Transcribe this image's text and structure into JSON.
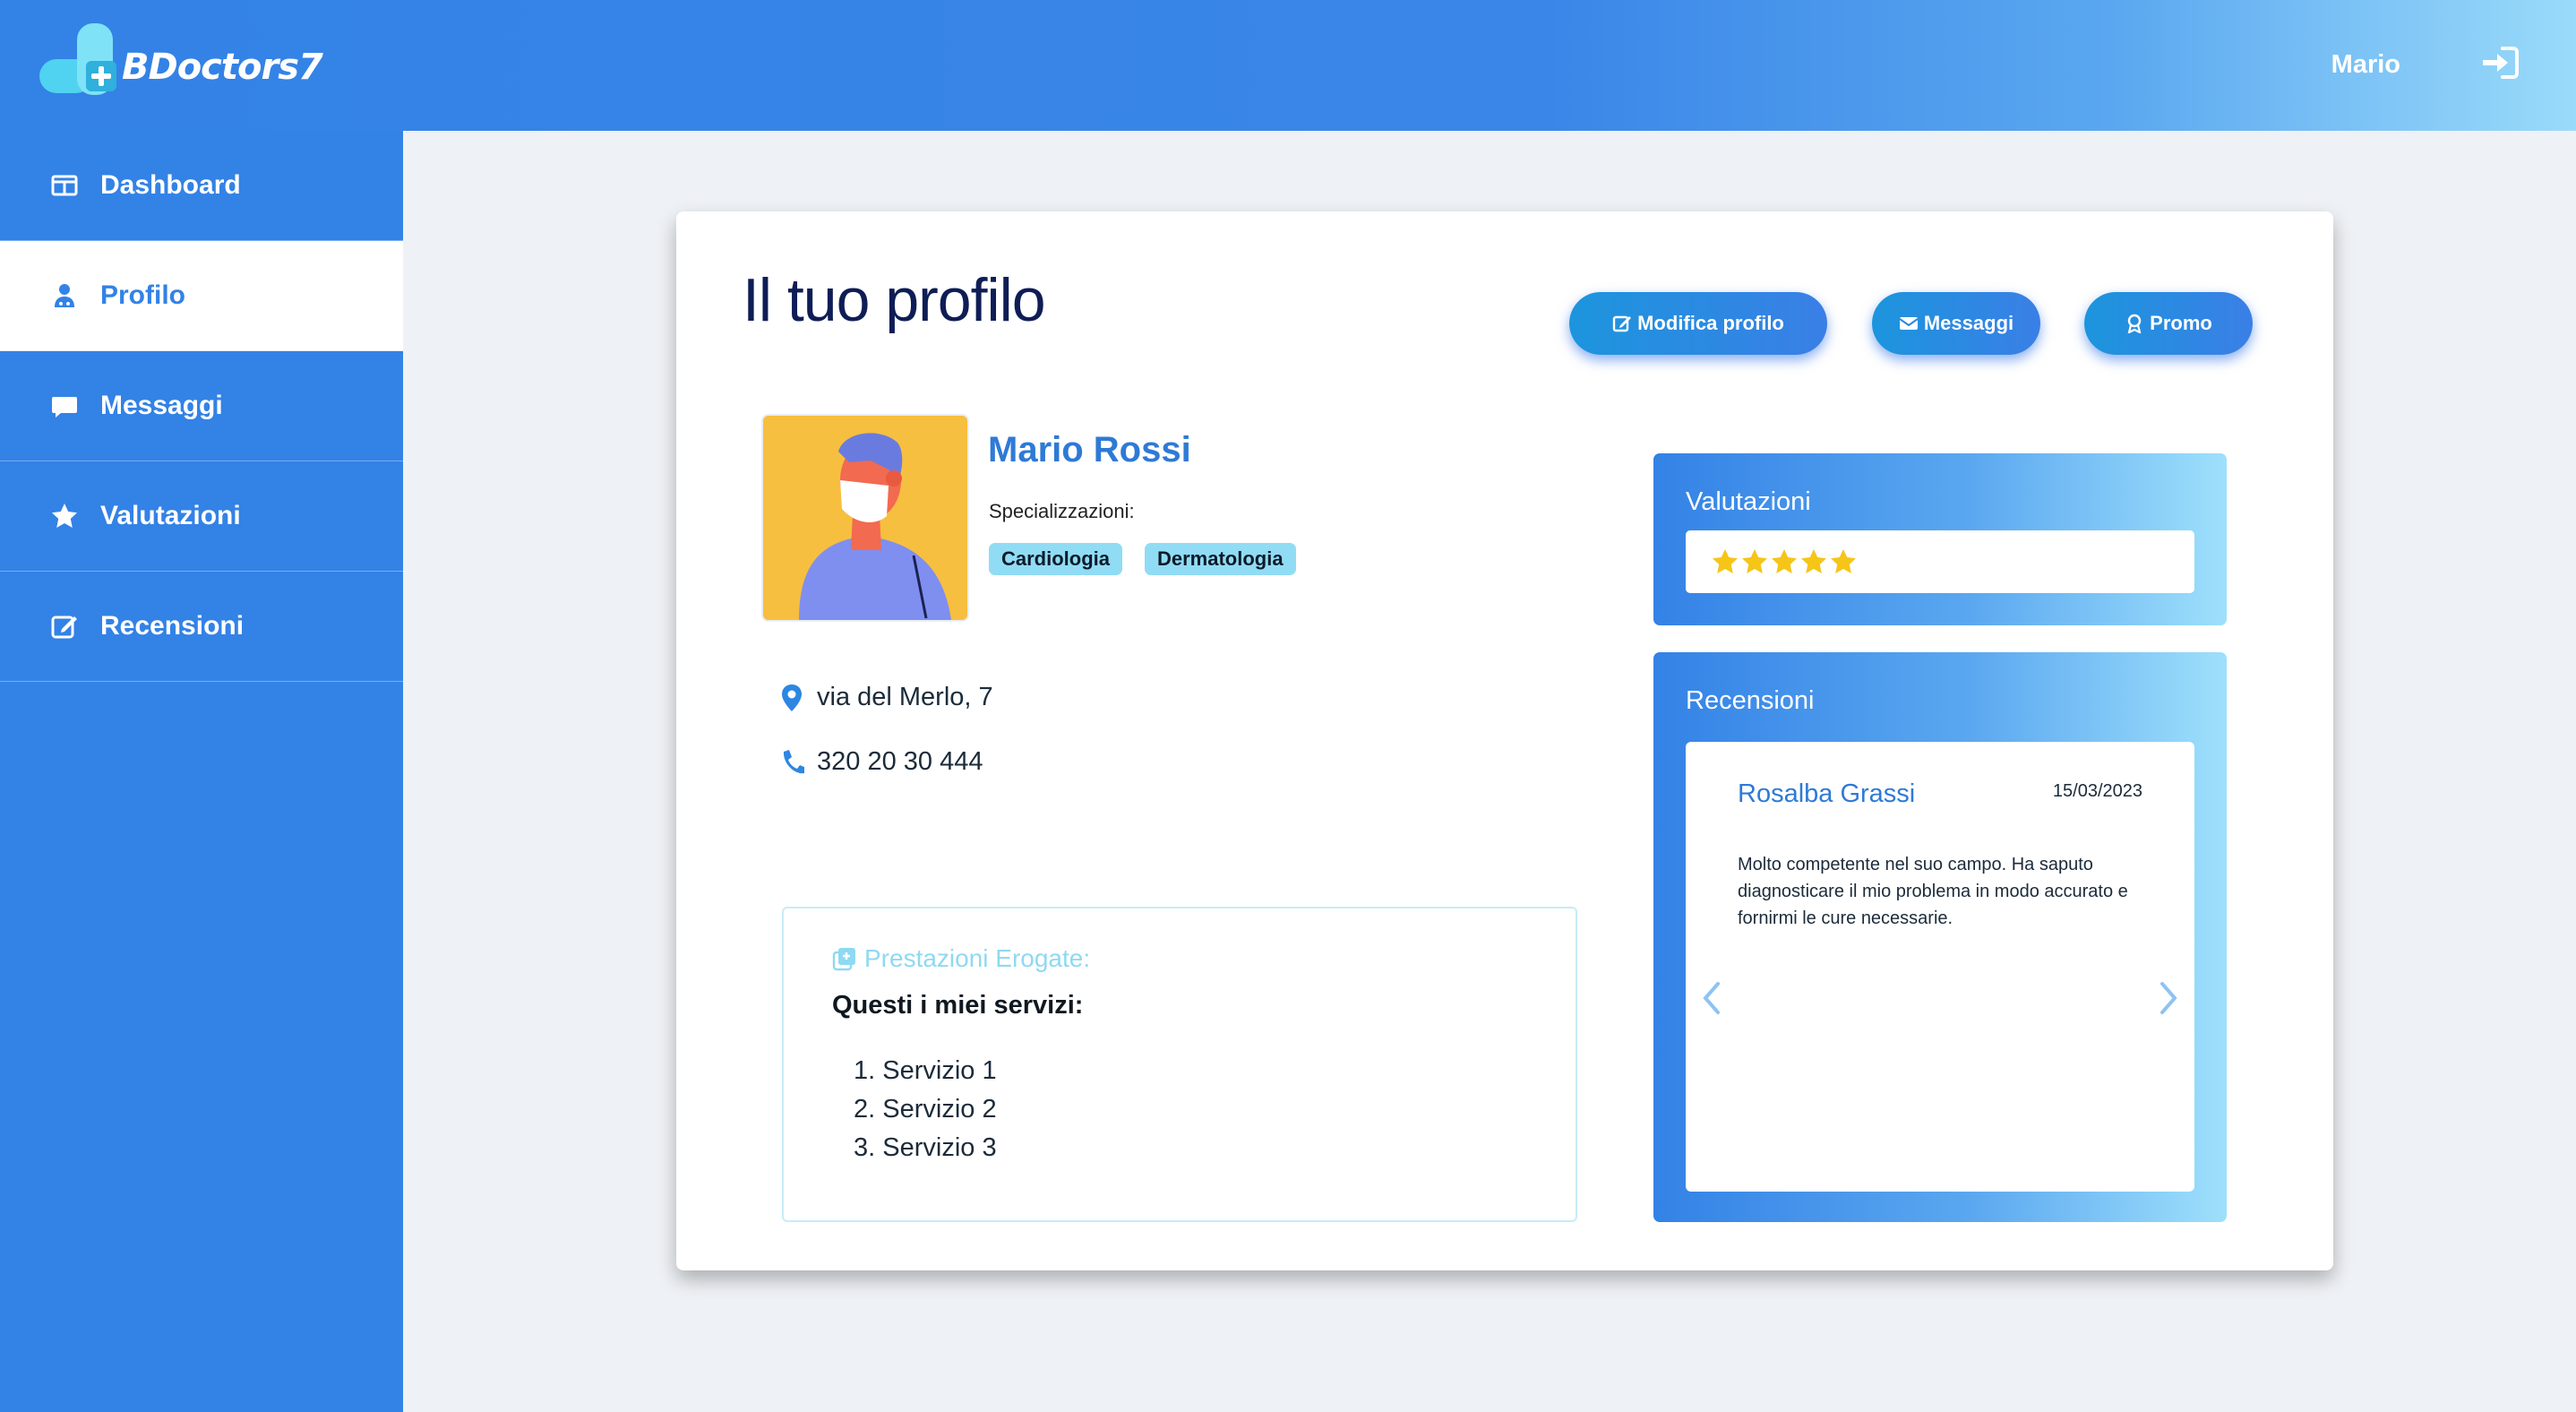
{
  "app": {
    "logo_text": "BDoctors7",
    "user_name": "Mario"
  },
  "sidebar": {
    "items": [
      {
        "label": "Dashboard",
        "icon": "dashboard-icon"
      },
      {
        "label": "Profilo",
        "icon": "user-doctor-icon",
        "active": true
      },
      {
        "label": "Messaggi",
        "icon": "message-icon"
      },
      {
        "label": "Valutazioni",
        "icon": "star-icon"
      },
      {
        "label": "Recensioni",
        "icon": "edit-icon"
      }
    ]
  },
  "main": {
    "title": "Il tuo profilo",
    "buttons": {
      "edit": "Modifica profilo",
      "messages": "Messaggi",
      "promo": "Promo"
    }
  },
  "profile": {
    "name": "Mario Rossi",
    "specializations_label": "Specializzazioni:",
    "specializations": [
      "Cardiologia",
      "Dermatologia"
    ],
    "address": "via del Merlo, 7",
    "phone": "320 20 30 444"
  },
  "services": {
    "title": "Prestazioni Erogate:",
    "subtitle": "Questi i miei servizi:",
    "items": [
      "Servizio 1",
      "Servizio 2",
      "Servizio 3"
    ]
  },
  "ratings": {
    "title": "Valutazioni",
    "stars": 5,
    "max_stars": 5,
    "star_color": "#f5c518"
  },
  "reviews": {
    "title": "Recensioni",
    "current": {
      "author": "Rosalba Grassi",
      "date": "15/03/2023",
      "text": "Molto competente nel suo campo. Ha saputo diagnosticare il mio problema in modo accurato e fornirmi le cure necessarie."
    }
  },
  "colors": {
    "primary": "#3382e6",
    "accent_light": "#9ee0fb",
    "title_dark": "#0f1d56",
    "tag_bg": "#90dcf5"
  }
}
